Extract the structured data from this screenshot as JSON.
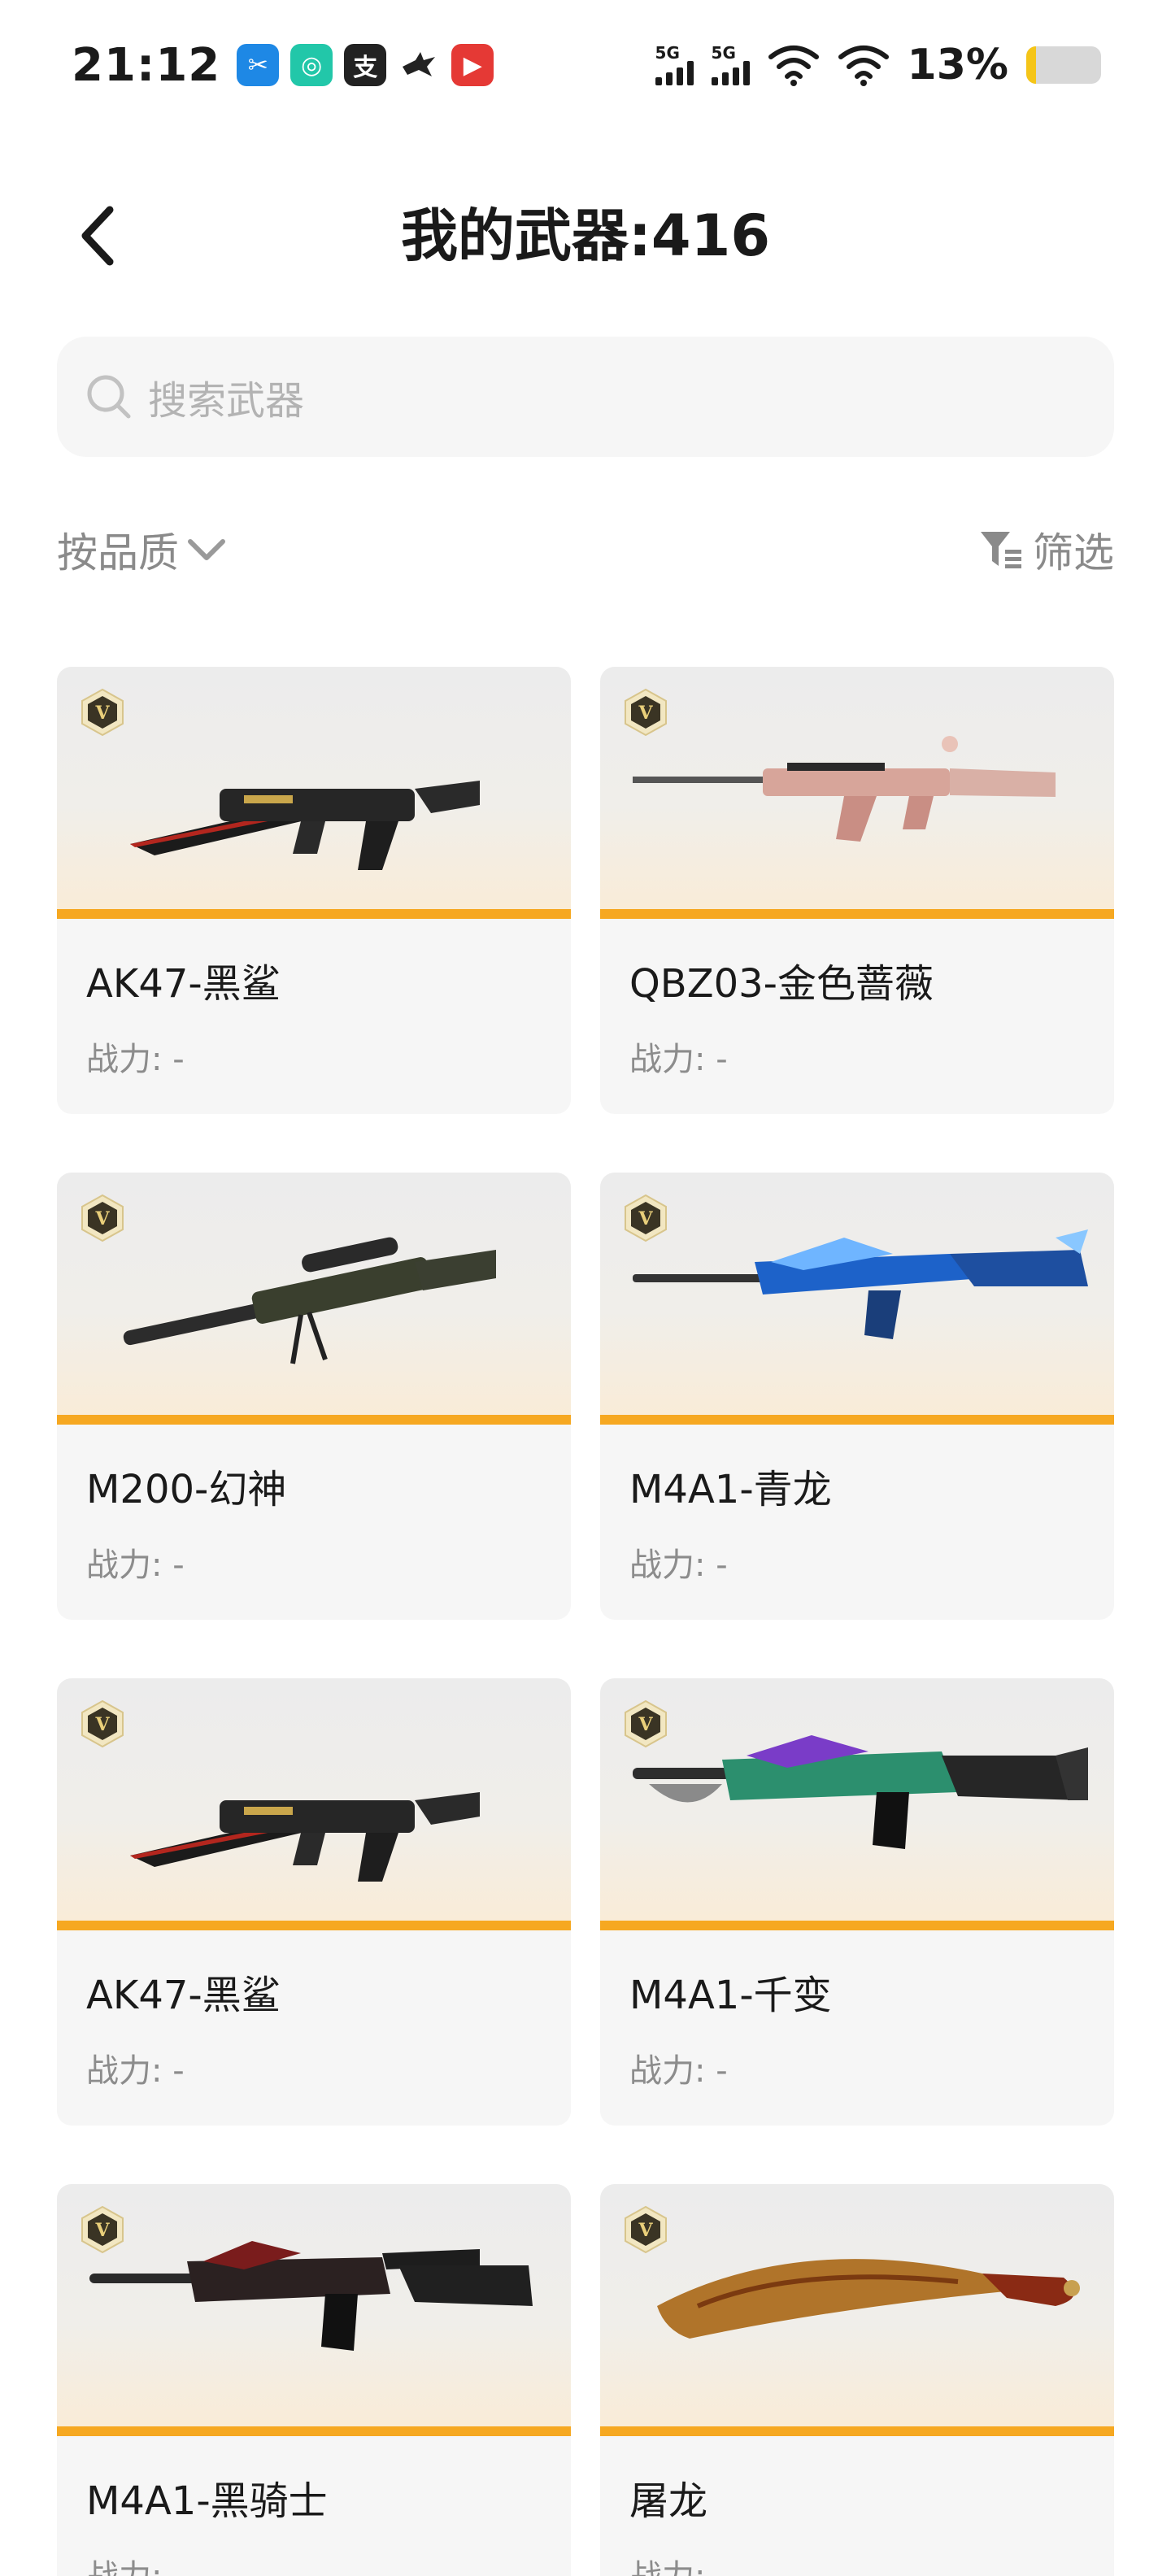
{
  "status_bar": {
    "time": "21:12",
    "apps": [
      {
        "icon": "scissors-app-icon",
        "color": "#1e88e5",
        "glyph": "✂"
      },
      {
        "icon": "camera-app-icon",
        "color": "#22c7a9",
        "glyph": "◎"
      },
      {
        "icon": "alipay-app-icon",
        "color": "#222222",
        "glyph": "支"
      },
      {
        "icon": "bird-app-icon",
        "color": "#ffffff",
        "glyph": ""
      },
      {
        "icon": "video-app-icon",
        "color": "#e53935",
        "glyph": "▶"
      }
    ],
    "signal1_label": "5G",
    "signal2_label": "5G",
    "battery_text": "13%",
    "battery_level": 0.13,
    "battery_color": "#f5c518"
  },
  "header": {
    "title": "我的武器:416",
    "back_icon": "chevron-left-icon"
  },
  "search": {
    "placeholder": "搜索武器",
    "icon": "search-icon"
  },
  "filters": {
    "sort_label": "按品质",
    "filter_label": "筛选"
  },
  "weapons": [
    {
      "name": "AK47-黑鲨",
      "power": "战力: -",
      "art": "ak47"
    },
    {
      "name": "QBZ03-金色蔷薇",
      "power": "战力: -",
      "art": "qbz"
    },
    {
      "name": "M200-幻神",
      "power": "战力: -",
      "art": "sniper"
    },
    {
      "name": "M4A1-青龙",
      "power": "战力: -",
      "art": "m4blue"
    },
    {
      "name": "AK47-黑鲨",
      "power": "战力: -",
      "art": "ak47"
    },
    {
      "name": "M4A1-千变",
      "power": "战力: -",
      "art": "m4rainbow"
    },
    {
      "name": "M4A1-黑骑士",
      "power": "战力: -",
      "art": "m4dark"
    },
    {
      "name": "屠龙",
      "power": "战力: -",
      "art": "knife"
    }
  ],
  "colors": {
    "accent": "#f6a821",
    "card_bg": "#f6f6f6",
    "muted_text": "#8c8c8c"
  }
}
